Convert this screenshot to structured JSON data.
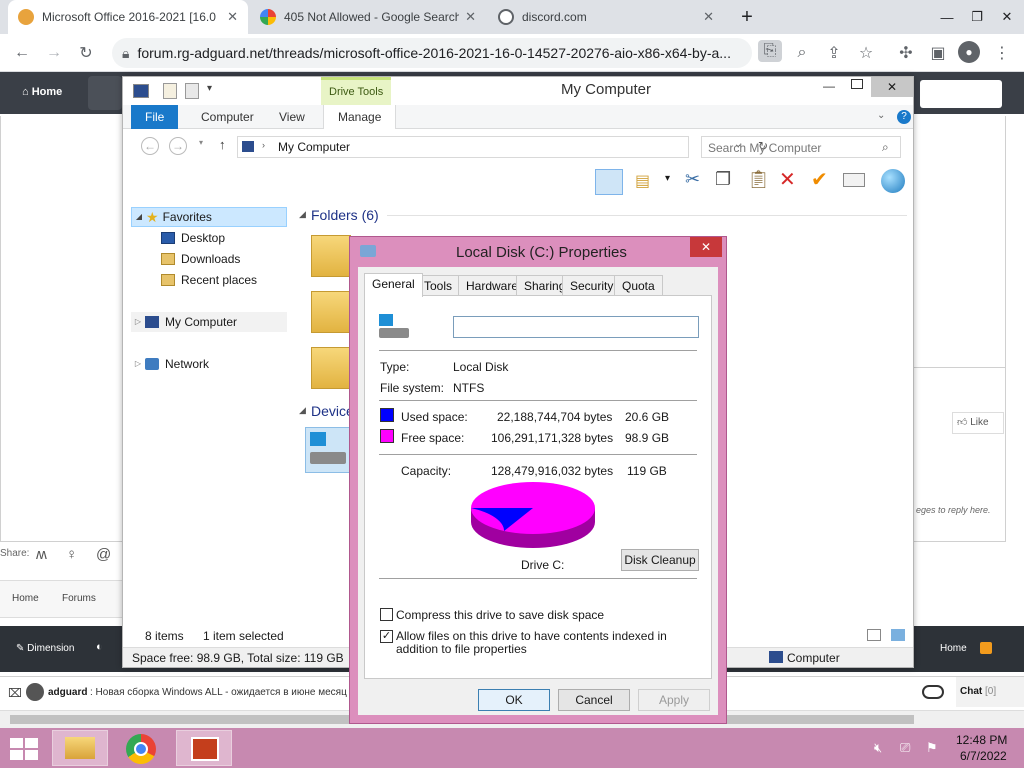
{
  "browser": {
    "tabs": [
      {
        "label": "Microsoft Office 2016-2021 [16.0",
        "close": "✕"
      },
      {
        "label": "405 Not Allowed - Google Search",
        "close": "✕"
      },
      {
        "label": "discord.com",
        "close": "✕"
      }
    ],
    "new_tab": "+",
    "url": "forum.rg-adguard.net/threads/microsoft-office-2016-2021-16-0-14527-20276-aio-x86-x64-by-a..."
  },
  "website": {
    "home": "Home",
    "share_label": "Share:",
    "breadcrumbs": [
      "Home",
      "Forums"
    ],
    "like": "Like",
    "reply_hint": "eges to reply here.",
    "footer_left": "Dimension",
    "footer_right": "Home",
    "chat_user": "adguard",
    "chat_text": ": Новая сборка Windows ALL - ожидается в июне месяц",
    "chat_label": "Chat",
    "chat_count": "[0]"
  },
  "explorer": {
    "title": "My Computer",
    "context_tab": "Drive Tools",
    "ribbon_tabs": [
      "File",
      "Computer",
      "View",
      "Manage"
    ],
    "address": "My Computer",
    "search_placeholder": "Search My Computer",
    "nav": {
      "favorites": "Favorites",
      "desktop": "Desktop",
      "downloads": "Downloads",
      "recent": "Recent places",
      "computer": "My Computer",
      "network": "Network"
    },
    "folders_header": "Folders (6)",
    "devices_header": "Device",
    "items_count": "8 items",
    "selected": "1 item selected",
    "space_status": "Space free: 98.9 GB, Total size: 119 GB",
    "status_computer": "Computer"
  },
  "dialog": {
    "title": "Local Disk (C:) Properties",
    "close": "✕",
    "tabs": [
      "General",
      "Tools",
      "Hardware",
      "Sharing",
      "Security",
      "Quota"
    ],
    "name_value": "",
    "type_label": "Type:",
    "type_value": "Local Disk",
    "fs_label": "File system:",
    "fs_value": "NTFS",
    "used_label": "Used space:",
    "used_bytes": "22,188,744,704 bytes",
    "used_gb": "20.6 GB",
    "free_label": "Free space:",
    "free_bytes": "106,291,171,328 bytes",
    "free_gb": "98.9 GB",
    "cap_label": "Capacity:",
    "cap_bytes": "128,479,916,032 bytes",
    "cap_gb": "119 GB",
    "drive_label": "Drive C:",
    "cleanup": "Disk Cleanup",
    "compress": "Compress this drive to save disk space",
    "index": "Allow files on this drive to have contents indexed in addition to file properties",
    "ok": "OK",
    "cancel": "Cancel",
    "apply": "Apply",
    "used_fraction": 0.1727,
    "used_color": "#0000ff",
    "free_color": "#ff00ff"
  },
  "taskbar": {
    "time": "12:48 PM",
    "date": "6/7/2022"
  }
}
